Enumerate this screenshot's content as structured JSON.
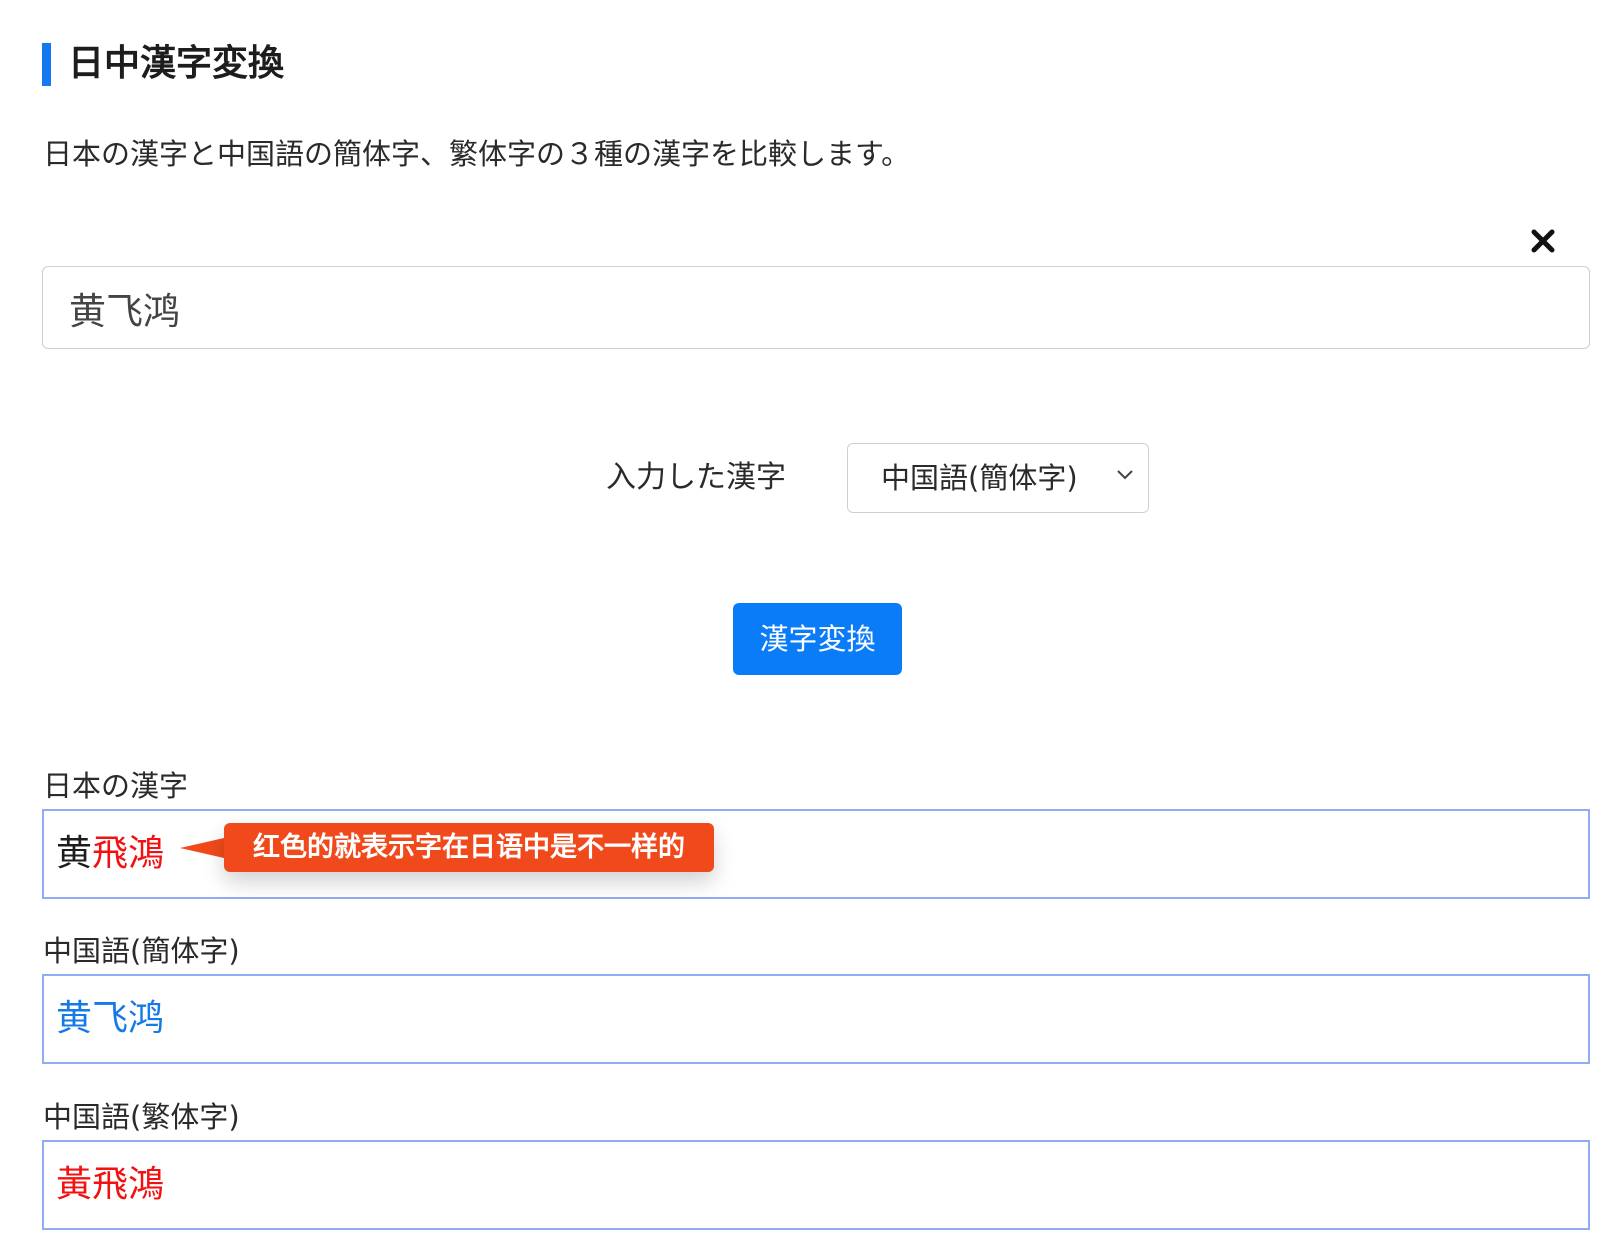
{
  "header": {
    "title": "日中漢字変換"
  },
  "description": "日本の漢字と中国語の簡体字、繁体字の３種の漢字を比較します。",
  "input": {
    "value": "黄飞鸿",
    "clear_icon": "close-icon"
  },
  "mode": {
    "label": "入力した漢字",
    "selected": "中国語(簡体字)"
  },
  "convert_button": {
    "label": "漢字変換"
  },
  "results": {
    "japanese": {
      "label": "日本の漢字",
      "char1": "黄",
      "char2": "飛",
      "char3": "鴻"
    },
    "simplified": {
      "label": "中国語(簡体字)",
      "text": "黄飞鸿"
    },
    "traditional": {
      "label": "中国語(繁体字)",
      "text": "黃飛鴻"
    }
  },
  "annotation": {
    "text": "红色的就表示字在日语中是不一样的"
  },
  "colors": {
    "accent": "#1478f0",
    "button": "#0a7cf7",
    "diff_red": "#f31010",
    "simplified_blue": "#1679e8",
    "result_border": "#8fadf0",
    "tooltip": "#f04a1c"
  }
}
